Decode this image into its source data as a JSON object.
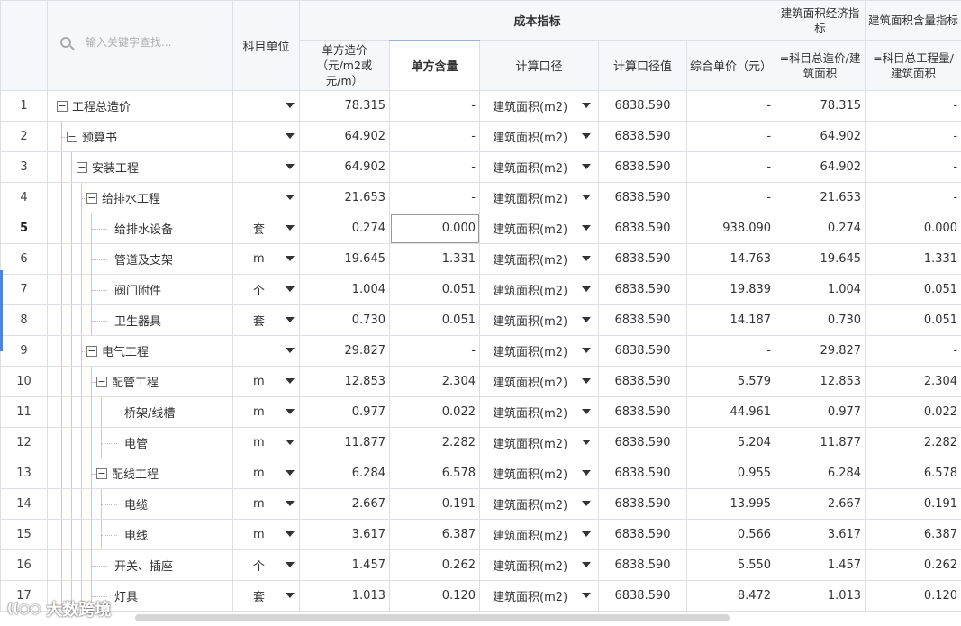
{
  "header": {
    "search_placeholder": "输入关键字查找...",
    "unit": "科目单位",
    "group": "成本指标",
    "unit_cost": "单方造价（元/m2或元/m）",
    "unit_qty": "单方含量",
    "calc_basis": "计算口径",
    "calc_basis_value": "计算口径值",
    "composite_price": "综合单价（元）",
    "area_econ": "建筑面积经济指标",
    "area_econ_formula": "=科目总造价/建筑面积",
    "area_qty": "建筑面积含量指标",
    "area_qty_formula": "=科目总工程量/建筑面积"
  },
  "rows": [
    {
      "no": "1",
      "name": "工程总造价",
      "unit": "",
      "cost": "78.315",
      "qty": "-",
      "basis": "建筑面积(m2)",
      "bval": "6838.590",
      "price": "-",
      "econ": "78.315",
      "aqty": "-"
    },
    {
      "no": "2",
      "name": "预算书",
      "unit": "",
      "cost": "64.902",
      "qty": "-",
      "basis": "建筑面积(m2)",
      "bval": "6838.590",
      "price": "-",
      "econ": "64.902",
      "aqty": "-"
    },
    {
      "no": "3",
      "name": "安装工程",
      "unit": "",
      "cost": "64.902",
      "qty": "-",
      "basis": "建筑面积(m2)",
      "bval": "6838.590",
      "price": "-",
      "econ": "64.902",
      "aqty": "-"
    },
    {
      "no": "4",
      "name": "给排水工程",
      "unit": "",
      "cost": "21.653",
      "qty": "-",
      "basis": "建筑面积(m2)",
      "bval": "6838.590",
      "price": "-",
      "econ": "21.653",
      "aqty": "-"
    },
    {
      "no": "5",
      "name": "给排水设备",
      "unit": "套",
      "cost": "0.274",
      "qty": "0.000",
      "basis": "建筑面积(m2)",
      "bval": "6838.590",
      "price": "938.090",
      "econ": "0.274",
      "aqty": "0.000"
    },
    {
      "no": "6",
      "name": "管道及支架",
      "unit": "m",
      "cost": "19.645",
      "qty": "1.331",
      "basis": "建筑面积(m2)",
      "bval": "6838.590",
      "price": "14.763",
      "econ": "19.645",
      "aqty": "1.331"
    },
    {
      "no": "7",
      "name": "阀门附件",
      "unit": "个",
      "cost": "1.004",
      "qty": "0.051",
      "basis": "建筑面积(m2)",
      "bval": "6838.590",
      "price": "19.839",
      "econ": "1.004",
      "aqty": "0.051"
    },
    {
      "no": "8",
      "name": "卫生器具",
      "unit": "套",
      "cost": "0.730",
      "qty": "0.051",
      "basis": "建筑面积(m2)",
      "bval": "6838.590",
      "price": "14.187",
      "econ": "0.730",
      "aqty": "0.051"
    },
    {
      "no": "9",
      "name": "电气工程",
      "unit": "",
      "cost": "29.827",
      "qty": "-",
      "basis": "建筑面积(m2)",
      "bval": "6838.590",
      "price": "-",
      "econ": "29.827",
      "aqty": "-"
    },
    {
      "no": "10",
      "name": "配管工程",
      "unit": "m",
      "cost": "12.853",
      "qty": "2.304",
      "basis": "建筑面积(m2)",
      "bval": "6838.590",
      "price": "5.579",
      "econ": "12.853",
      "aqty": "2.304"
    },
    {
      "no": "11",
      "name": "桥架/线槽",
      "unit": "m",
      "cost": "0.977",
      "qty": "0.022",
      "basis": "建筑面积(m2)",
      "bval": "6838.590",
      "price": "44.961",
      "econ": "0.977",
      "aqty": "0.022"
    },
    {
      "no": "12",
      "name": "电管",
      "unit": "m",
      "cost": "11.877",
      "qty": "2.282",
      "basis": "建筑面积(m2)",
      "bval": "6838.590",
      "price": "5.204",
      "econ": "11.877",
      "aqty": "2.282"
    },
    {
      "no": "13",
      "name": "配线工程",
      "unit": "m",
      "cost": "6.284",
      "qty": "6.578",
      "basis": "建筑面积(m2)",
      "bval": "6838.590",
      "price": "0.955",
      "econ": "6.284",
      "aqty": "6.578"
    },
    {
      "no": "14",
      "name": "电缆",
      "unit": "m",
      "cost": "2.667",
      "qty": "0.191",
      "basis": "建筑面积(m2)",
      "bval": "6838.590",
      "price": "13.995",
      "econ": "2.667",
      "aqty": "0.191"
    },
    {
      "no": "15",
      "name": "电线",
      "unit": "m",
      "cost": "3.617",
      "qty": "6.387",
      "basis": "建筑面积(m2)",
      "bval": "6838.590",
      "price": "0.566",
      "econ": "3.617",
      "aqty": "6.387"
    },
    {
      "no": "16",
      "name": "开关、插座",
      "unit": "个",
      "cost": "1.457",
      "qty": "0.262",
      "basis": "建筑面积(m2)",
      "bval": "6838.590",
      "price": "5.550",
      "econ": "1.457",
      "aqty": "0.262"
    },
    {
      "no": "17",
      "name": "灯具",
      "unit": "套",
      "cost": "1.013",
      "qty": "0.120",
      "basis": "建筑面积(m2)",
      "bval": "6838.590",
      "price": "8.472",
      "econ": "1.013",
      "aqty": "0.120"
    }
  ],
  "watermark": "大数跨境",
  "icons": {
    "search": "search-icon",
    "collapse": "collapse-icon",
    "dropdown": "chevron-down-icon"
  }
}
